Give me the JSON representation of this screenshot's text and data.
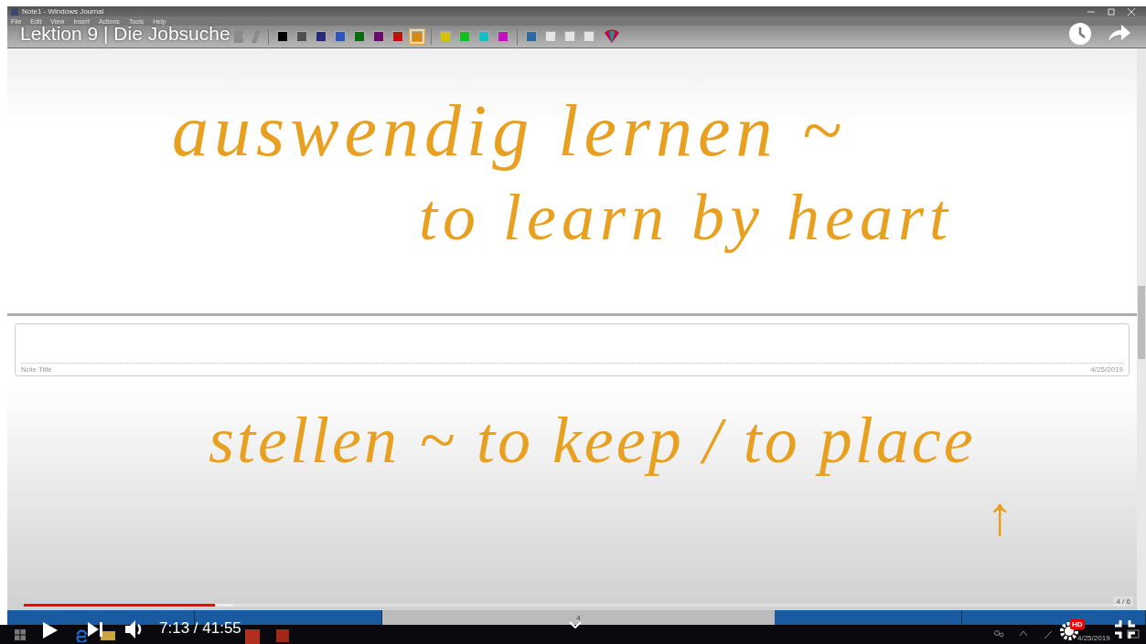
{
  "window": {
    "title": "Note1 - Windows Journal"
  },
  "menu": [
    "File",
    "Edit",
    "View",
    "Insert",
    "Actions",
    "Tools",
    "Help"
  ],
  "swatches": [
    {
      "color": "#000000",
      "selected": false
    },
    {
      "color": "#505050",
      "selected": false
    },
    {
      "color": "#2a2a7a",
      "selected": false
    },
    {
      "color": "#2a55c0",
      "selected": false
    },
    {
      "color": "#0b6b12",
      "selected": false
    },
    {
      "color": "#6a0a6a",
      "selected": false
    },
    {
      "color": "#c01010",
      "selected": false
    },
    {
      "color": "#d88a10",
      "selected": true
    },
    {
      "color": "#d4c400",
      "selected": false
    },
    {
      "color": "#12c020",
      "selected": false
    },
    {
      "color": "#12c0c0",
      "selected": false
    },
    {
      "color": "#c012c0",
      "selected": false
    },
    {
      "color": "#2a6aa0",
      "selected": false
    },
    {
      "color": "#e4e4e4",
      "selected": false
    },
    {
      "color": "#e4e4e4",
      "selected": false
    },
    {
      "color": "#e4e4e4",
      "selected": false
    }
  ],
  "video": {
    "title": "Lektion 9 | Die Jobsuche",
    "time": "7:13 / 41:55",
    "progress": {
      "level": 0.174
    },
    "buffered": {
      "level": 0.19
    },
    "quality_badge": "HD"
  },
  "page": {
    "ink_top": [
      "auswendig lernen ~",
      "to learn by heart"
    ],
    "note_title": {
      "placeholder": "Note Title"
    },
    "date": "4/25/2019",
    "ink_bottom": [
      "stellen ~ to keep / to place",
      "↑"
    ],
    "page_indicator": "4 / 6"
  },
  "status_bar": {
    "page": "4"
  },
  "taskbar": {
    "date": "4/25/2019"
  }
}
